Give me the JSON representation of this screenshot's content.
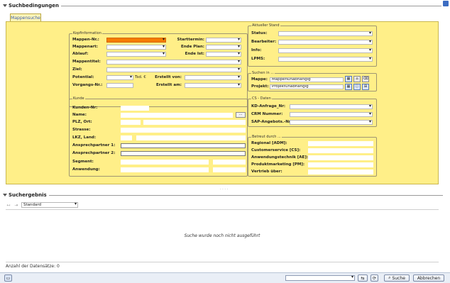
{
  "search_conditions": {
    "title": "Suchbedingungen",
    "tab_label": "Mappensuche",
    "kopfinformation": {
      "title": "Kopfinformation",
      "mappen_nr": "Mappen-Nr.:",
      "mappenart": "Mappenart:",
      "ablauf": "Ablauf:",
      "mappentitel": "Mappentitel:",
      "ziel": "Ziel:",
      "potential": "Potential:",
      "potential_unit": "Tsd. €",
      "vorgangs_nr": "Vorgangs-Nr.:",
      "starttermin": "Starttermin:",
      "ende_plan": "Ende Plan:",
      "ende_ist": "Ende Ist:",
      "erstellt_von": "Erstellt von:",
      "erstellt_am": "Erstellt am:"
    },
    "aktueller_stand": {
      "title": "Aktueller Stand",
      "status": "Status:",
      "bearbeiter": "Bearbeiter:",
      "info": "Info:",
      "lpms": "LPMS:"
    },
    "suchen_in": {
      "title": "Suchen in ...",
      "mappe_label": "Mappe:",
      "mappe_value": "Mappenunabhängig",
      "projekt_label": "Projekt:",
      "projekt_value": "Projektunabhängig"
    },
    "kunde": {
      "title": "Kunde",
      "kunden_nr": "Kunden-Nr:",
      "name": "Name:",
      "plz_ort": "PLZ, Ort:",
      "strasse": "Strasse:",
      "lkz_land": "LKZ, Land:",
      "ansprechpartner_1": "Ansprechpartner 1:",
      "ansprechpartner_2": "Ansprechpartner 2:",
      "segment": "Segment:",
      "anwendung": "Anwendung:",
      "lookup_btn": "..."
    },
    "cs_daten": {
      "title": "CS - Daten",
      "kd_anfrage": "KD-Anfrage_Nr:",
      "crm_nummer": "CRM Nummer:",
      "sap_angebots": "SAP-Angebots.-Nr:"
    },
    "betreut_durch": {
      "title": "Betreut durch ...",
      "regional": "Regional [ADM]:",
      "customerservice": "Customerservice [CS]:",
      "anwendungstechnik": "Anwendungstechnik [AE]:",
      "produktmarketing": "Produktmarketing [PM]:",
      "vertrieb": "Vertrieb über:"
    }
  },
  "search_result": {
    "title": "Suchergebnis",
    "view_value": "Standard",
    "empty_message": "Suche wurde noch nicht ausgeführt",
    "count_label": "Anzahl der Datensätze: 0"
  },
  "footer": {
    "search_button": "Suche",
    "cancel_button": "Abbrechen"
  },
  "colors": {
    "panel_yellow": "#ffef88",
    "mandatory_orange": "#f57c00",
    "link_blue": "#3a5fb0"
  }
}
